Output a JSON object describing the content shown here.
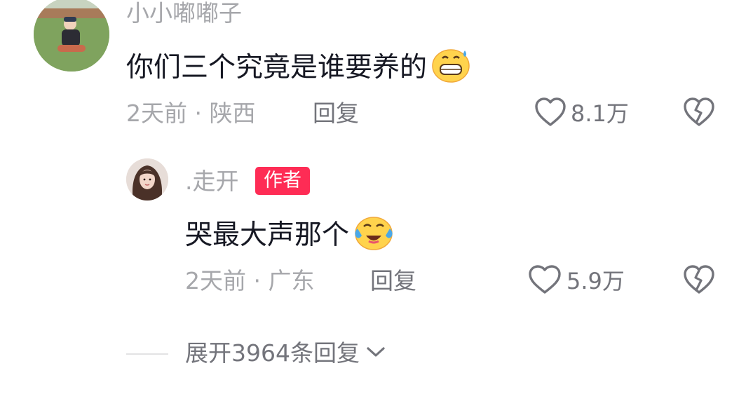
{
  "comment": {
    "username": "小小嘟嘟子",
    "text": "你们三个究竟是谁要养的",
    "emoji": "grinning-sweat-emoji",
    "time": "2天前",
    "separator": "·",
    "location": "陕西",
    "reply_label": "回复",
    "like_count": "8.1万"
  },
  "reply": {
    "username": ".走开",
    "badge": "作者",
    "text": "哭最大声那个",
    "emoji": "crying-laughing-emoji",
    "time": "2天前",
    "separator": "·",
    "location": "广东",
    "reply_label": "回复",
    "like_count": "5.9万"
  },
  "expand": {
    "label": "展开3964条回复"
  },
  "colors": {
    "text": "#161823",
    "muted": "#a6a7ab",
    "secondary": "#73747b",
    "badge": "#fe2c55"
  }
}
